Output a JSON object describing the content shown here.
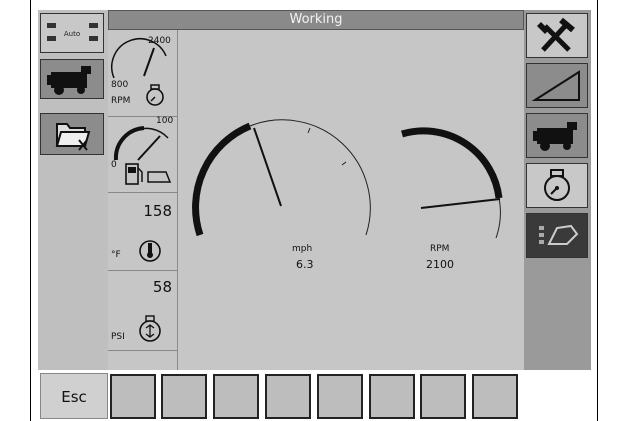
{
  "title": "Working",
  "left_buttons": [
    {
      "icon": "auto-display-icon",
      "label": "Auto"
    },
    {
      "icon": "combine-icon"
    },
    {
      "icon": "folder-icon"
    }
  ],
  "right_buttons": [
    {
      "icon": "tools-icon"
    },
    {
      "icon": "ramp-icon"
    },
    {
      "icon": "combine-icon"
    },
    {
      "icon": "engine-icon"
    },
    {
      "icon": "hand-settings-icon"
    }
  ],
  "side_gauges": {
    "rpm": {
      "min_label": "800",
      "max_label": "2400",
      "unit": "RPM"
    },
    "fuel": {
      "min_label": "0",
      "max_label": "100"
    },
    "temp": {
      "value": "158",
      "unit": "°F"
    },
    "pressure": {
      "value": "58",
      "unit": "PSI"
    }
  },
  "main_gauges": {
    "speed": {
      "label": "mph",
      "value": "6.3"
    },
    "rpm": {
      "label": "RPM",
      "value": "2100"
    }
  },
  "bottom": {
    "esc_label": "Esc",
    "function_key_count": 8
  }
}
